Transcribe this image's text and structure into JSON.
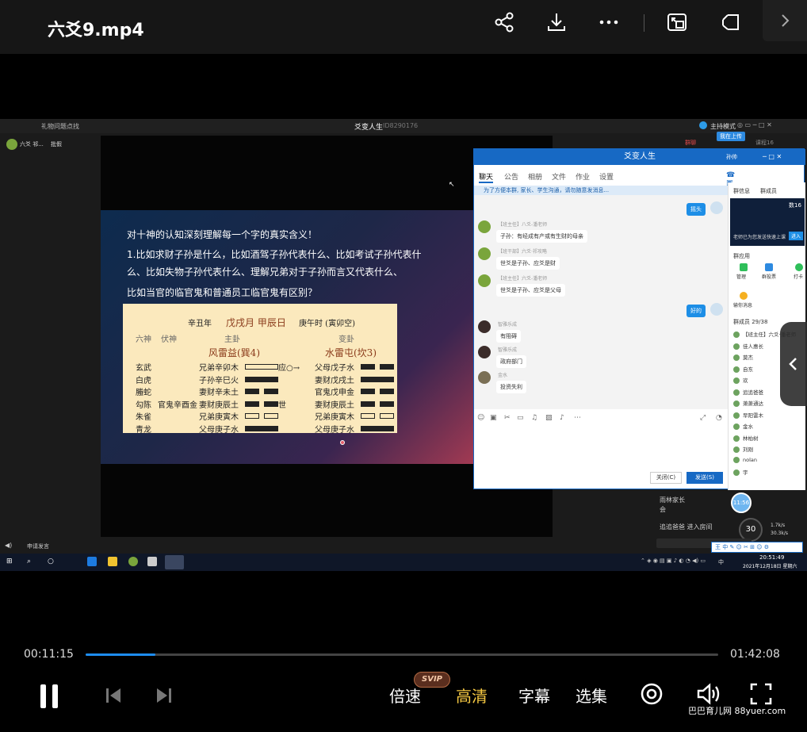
{
  "header": {
    "title": "六爻9.mp4"
  },
  "video_window": {
    "app_top_left": "礼物问题点找",
    "app_title": "爻变人生",
    "app_id": "ID8290176",
    "app_mode": "主持模式",
    "left_user": "六爻 祁...",
    "left_tag": "批假",
    "right_tab_1": "群聊",
    "right_tab_2": "课程16",
    "status_chip": "我在上传",
    "bottom_left": "申请发言"
  },
  "slide": {
    "line1": "对十神的认知深刻理解每一个字的真实含义！",
    "line2": "1.比如求财子孙是什么，比如酒驾子孙代表什么、比如考试子孙代表什",
    "line3": "么、比如失物子孙代表什么、理解兄弟对于子孙而言又代表什么、",
    "line4": "比如当官的临官鬼和普通员工临官鬼有区别？"
  },
  "gua_table": {
    "year": "辛丑年",
    "month_day": "戊戌月 甲辰日",
    "hour": "庚午时 (寅卯空)",
    "col_liushen": "六神",
    "col_fushen": "伏神",
    "col_ben": "主卦",
    "col_bian": "变卦",
    "ben_name": "风雷益(巽4)",
    "bian_name": "水雷屯(坎3)",
    "rows": [
      {
        "shen": "玄武",
        "fu": "",
        "ben": "兄弟辛卯木",
        "mark": "应○→",
        "bian": "父母戊子水"
      },
      {
        "shen": "白虎",
        "fu": "",
        "ben": "子孙辛巳火",
        "mark": "",
        "bian": "妻财戊戌土"
      },
      {
        "shen": "螣蛇",
        "fu": "",
        "ben": "妻财辛未土",
        "mark": "",
        "bian": "官鬼戊申金"
      },
      {
        "shen": "勾陈",
        "fu": "官鬼辛酉金",
        "ben": "妻财庚辰土",
        "mark": "世",
        "bian": "妻财庚辰土"
      },
      {
        "shen": "朱雀",
        "fu": "",
        "ben": "兄弟庚寅木",
        "mark": "",
        "bian": "兄弟庚寅木"
      },
      {
        "shen": "青龙",
        "fu": "",
        "ben": "父母庚子水",
        "mark": "",
        "bian": "父母庚子水"
      }
    ]
  },
  "qq": {
    "title": "爻变人生",
    "title_right": "孙帅",
    "tabs": [
      "聊天",
      "公告",
      "相册",
      "文件",
      "作业",
      "设置"
    ],
    "notice": "为了方便本群, 家长、学生沟通，请勿随意发消息...",
    "messages": [
      {
        "side": "me",
        "text": "摇头"
      },
      {
        "side": "other",
        "who": "【班主任】八爻-潘老师",
        "text": "子孙：有经成有产或有生财的母亲"
      },
      {
        "side": "other",
        "who": "【班干部】六爻·祁攻略",
        "text": "世爻是子孙、应爻是财"
      },
      {
        "side": "other",
        "who": "【班主任】六爻-潘老师",
        "text": "世爻是子孙、应爻是父母"
      },
      {
        "side": "me",
        "text": "好的"
      },
      {
        "side": "other",
        "who": "智雅乐成",
        "text": "有阻碍"
      },
      {
        "side": "other",
        "who": "智雅乐成",
        "text": "政府部门"
      },
      {
        "side": "other",
        "who": "金水",
        "text": "投资失利"
      }
    ],
    "btn_close": "关闭(C)",
    "btn_send": "发送(S)",
    "side_tab_1": "群信息",
    "side_tab_2": "群成员",
    "side_apps_title": "群应用",
    "side_app_1": "管理",
    "side_app_2": "群投票",
    "side_app_3": "打卡",
    "side_app_4": "输你消息",
    "members_title": "群成员 29/38",
    "members": [
      "【班主任】六爻·潘老师",
      "佳人惠长",
      "莫杰",
      "自东",
      "欢",
      "追追爸爸",
      "萧萧通达",
      "早阳雷木",
      "金水",
      "林柏树",
      "刘刚",
      "nolan",
      "宇"
    ],
    "ad_text": "老师已为您发送快速上课",
    "ad_btn": "进入",
    "count": "数16"
  },
  "right_extra": {
    "line1": "雨林家长",
    "line2": "会",
    "line3": "追追爸爸 进入房间",
    "speed_pct": "30",
    "speed_up": "1.7k/s",
    "speed_down": "30.3k/s",
    "badge": "11:56"
  },
  "taskbar": {
    "time": "20:51:49",
    "date": "2021年12月18日 星期六",
    "ime": "中"
  },
  "player": {
    "current_time": "00:11:15",
    "total_time": "01:42:08",
    "progress": 0.11,
    "speed_label": "倍速",
    "svip_label": "SVIP",
    "quality_label": "高清",
    "subtitle_label": "字幕",
    "episodes_label": "选集",
    "watermark": "巴巴育儿网 88yuer.com"
  },
  "colors": {
    "accent": "#1e8df0",
    "quality": "#f5c842",
    "qq_blue": "#1769c4"
  }
}
